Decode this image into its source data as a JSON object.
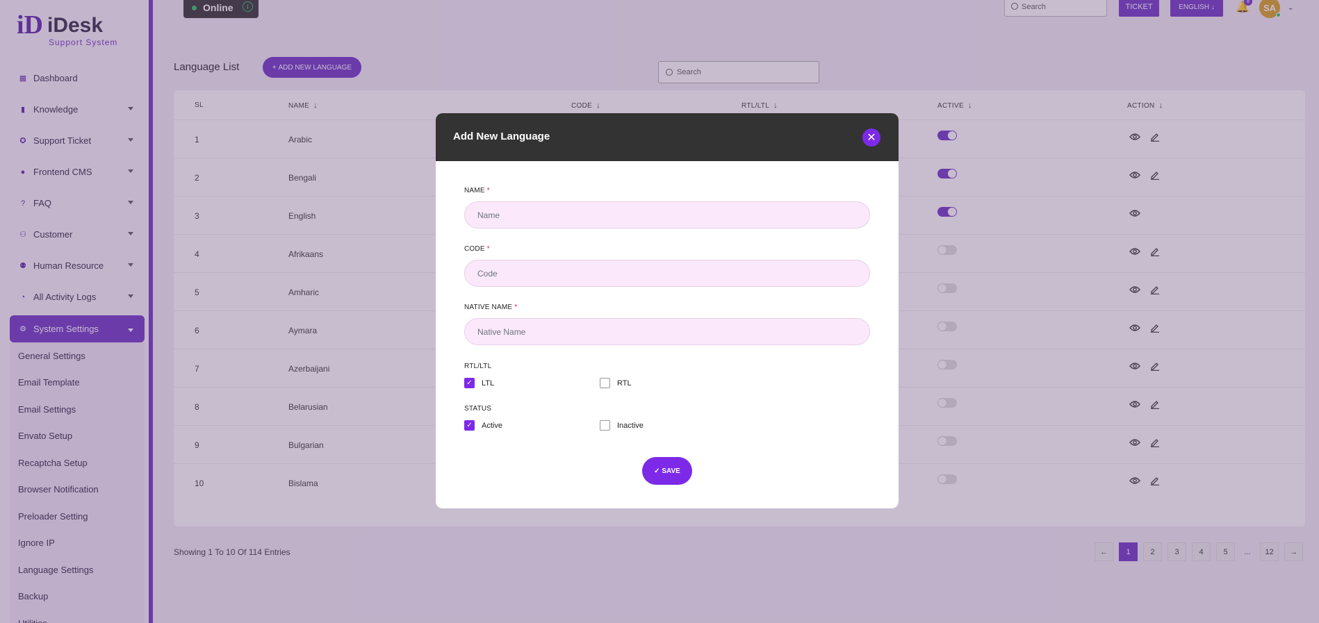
{
  "brand": {
    "mark": "iD",
    "name": "iDesk",
    "tagline": "Support System"
  },
  "sidebar": {
    "items": [
      {
        "label": "Dashboard",
        "icon": "grid-icon"
      },
      {
        "label": "Knowledge",
        "icon": "book-icon"
      },
      {
        "label": "Support Ticket",
        "icon": "ticket-icon"
      },
      {
        "label": "Frontend CMS",
        "icon": "user-icon"
      },
      {
        "label": "FAQ",
        "icon": "question-icon"
      },
      {
        "label": "Customer",
        "icon": "users-icon"
      },
      {
        "label": "Human Resource",
        "icon": "team-icon"
      },
      {
        "label": "All Activity Logs",
        "icon": "clock-icon"
      },
      {
        "label": "System Settings",
        "icon": "gear-icon"
      }
    ],
    "sub_items": [
      "General Settings",
      "Email Template",
      "Email Settings",
      "Envato Setup",
      "Recaptcha Setup",
      "Browser Notification",
      "Preloader Setting",
      "Ignore IP",
      "Language Settings",
      "Backup",
      "Utilities"
    ]
  },
  "header": {
    "status": "Online",
    "search_placeholder": "Search",
    "ticket_label": "TICKET",
    "language_label": "ENGLISH",
    "notification_count": "8",
    "avatar_initials": "SA"
  },
  "page": {
    "title": "Language List",
    "add_button": "ADD NEW LANGUAGE",
    "search_placeholder": "Search"
  },
  "table": {
    "columns": [
      "SL",
      "NAME",
      "CODE",
      "RTL/LTL",
      "ACTIVE",
      "ACTION"
    ],
    "rows": [
      {
        "sl": "1",
        "name": "Arabic",
        "active": true,
        "editable": true
      },
      {
        "sl": "2",
        "name": "Bengali",
        "active": true,
        "editable": true
      },
      {
        "sl": "3",
        "name": "English",
        "active": true,
        "editable": false
      },
      {
        "sl": "4",
        "name": "Afrikaans",
        "active": false,
        "editable": true
      },
      {
        "sl": "5",
        "name": "Amharic",
        "active": false,
        "editable": true
      },
      {
        "sl": "6",
        "name": "Aymara",
        "active": false,
        "editable": true
      },
      {
        "sl": "7",
        "name": "Azerbaijani",
        "active": false,
        "editable": true
      },
      {
        "sl": "8",
        "name": "Belarusian",
        "active": false,
        "editable": true
      },
      {
        "sl": "9",
        "name": "Bulgarian",
        "active": false,
        "editable": true
      },
      {
        "sl": "10",
        "name": "Bislama",
        "active": false,
        "editable": true
      }
    ]
  },
  "footer": {
    "showing": "Showing 1 To 10 Of 114 Entries",
    "pages": [
      "1",
      "2",
      "3",
      "4",
      "5",
      "...",
      "12"
    ]
  },
  "modal": {
    "title": "Add New Language",
    "name_label": "NAME",
    "name_placeholder": "Name",
    "code_label": "CODE",
    "code_placeholder": "Code",
    "native_label": "NATIVE NAME",
    "native_placeholder": "Native Name",
    "required_mark": "*",
    "direction_label": "RTL/LTL",
    "direction_options": [
      {
        "label": "LTL",
        "checked": true
      },
      {
        "label": "RTL",
        "checked": false
      }
    ],
    "status_label": "STATUS",
    "status_options": [
      {
        "label": "Active",
        "checked": true
      },
      {
        "label": "Inactive",
        "checked": false
      }
    ],
    "save_label": "SAVE"
  },
  "colors": {
    "accent": "#6a2fc4",
    "modal_header": "#333333",
    "input_bg": "#fbe9fb"
  }
}
